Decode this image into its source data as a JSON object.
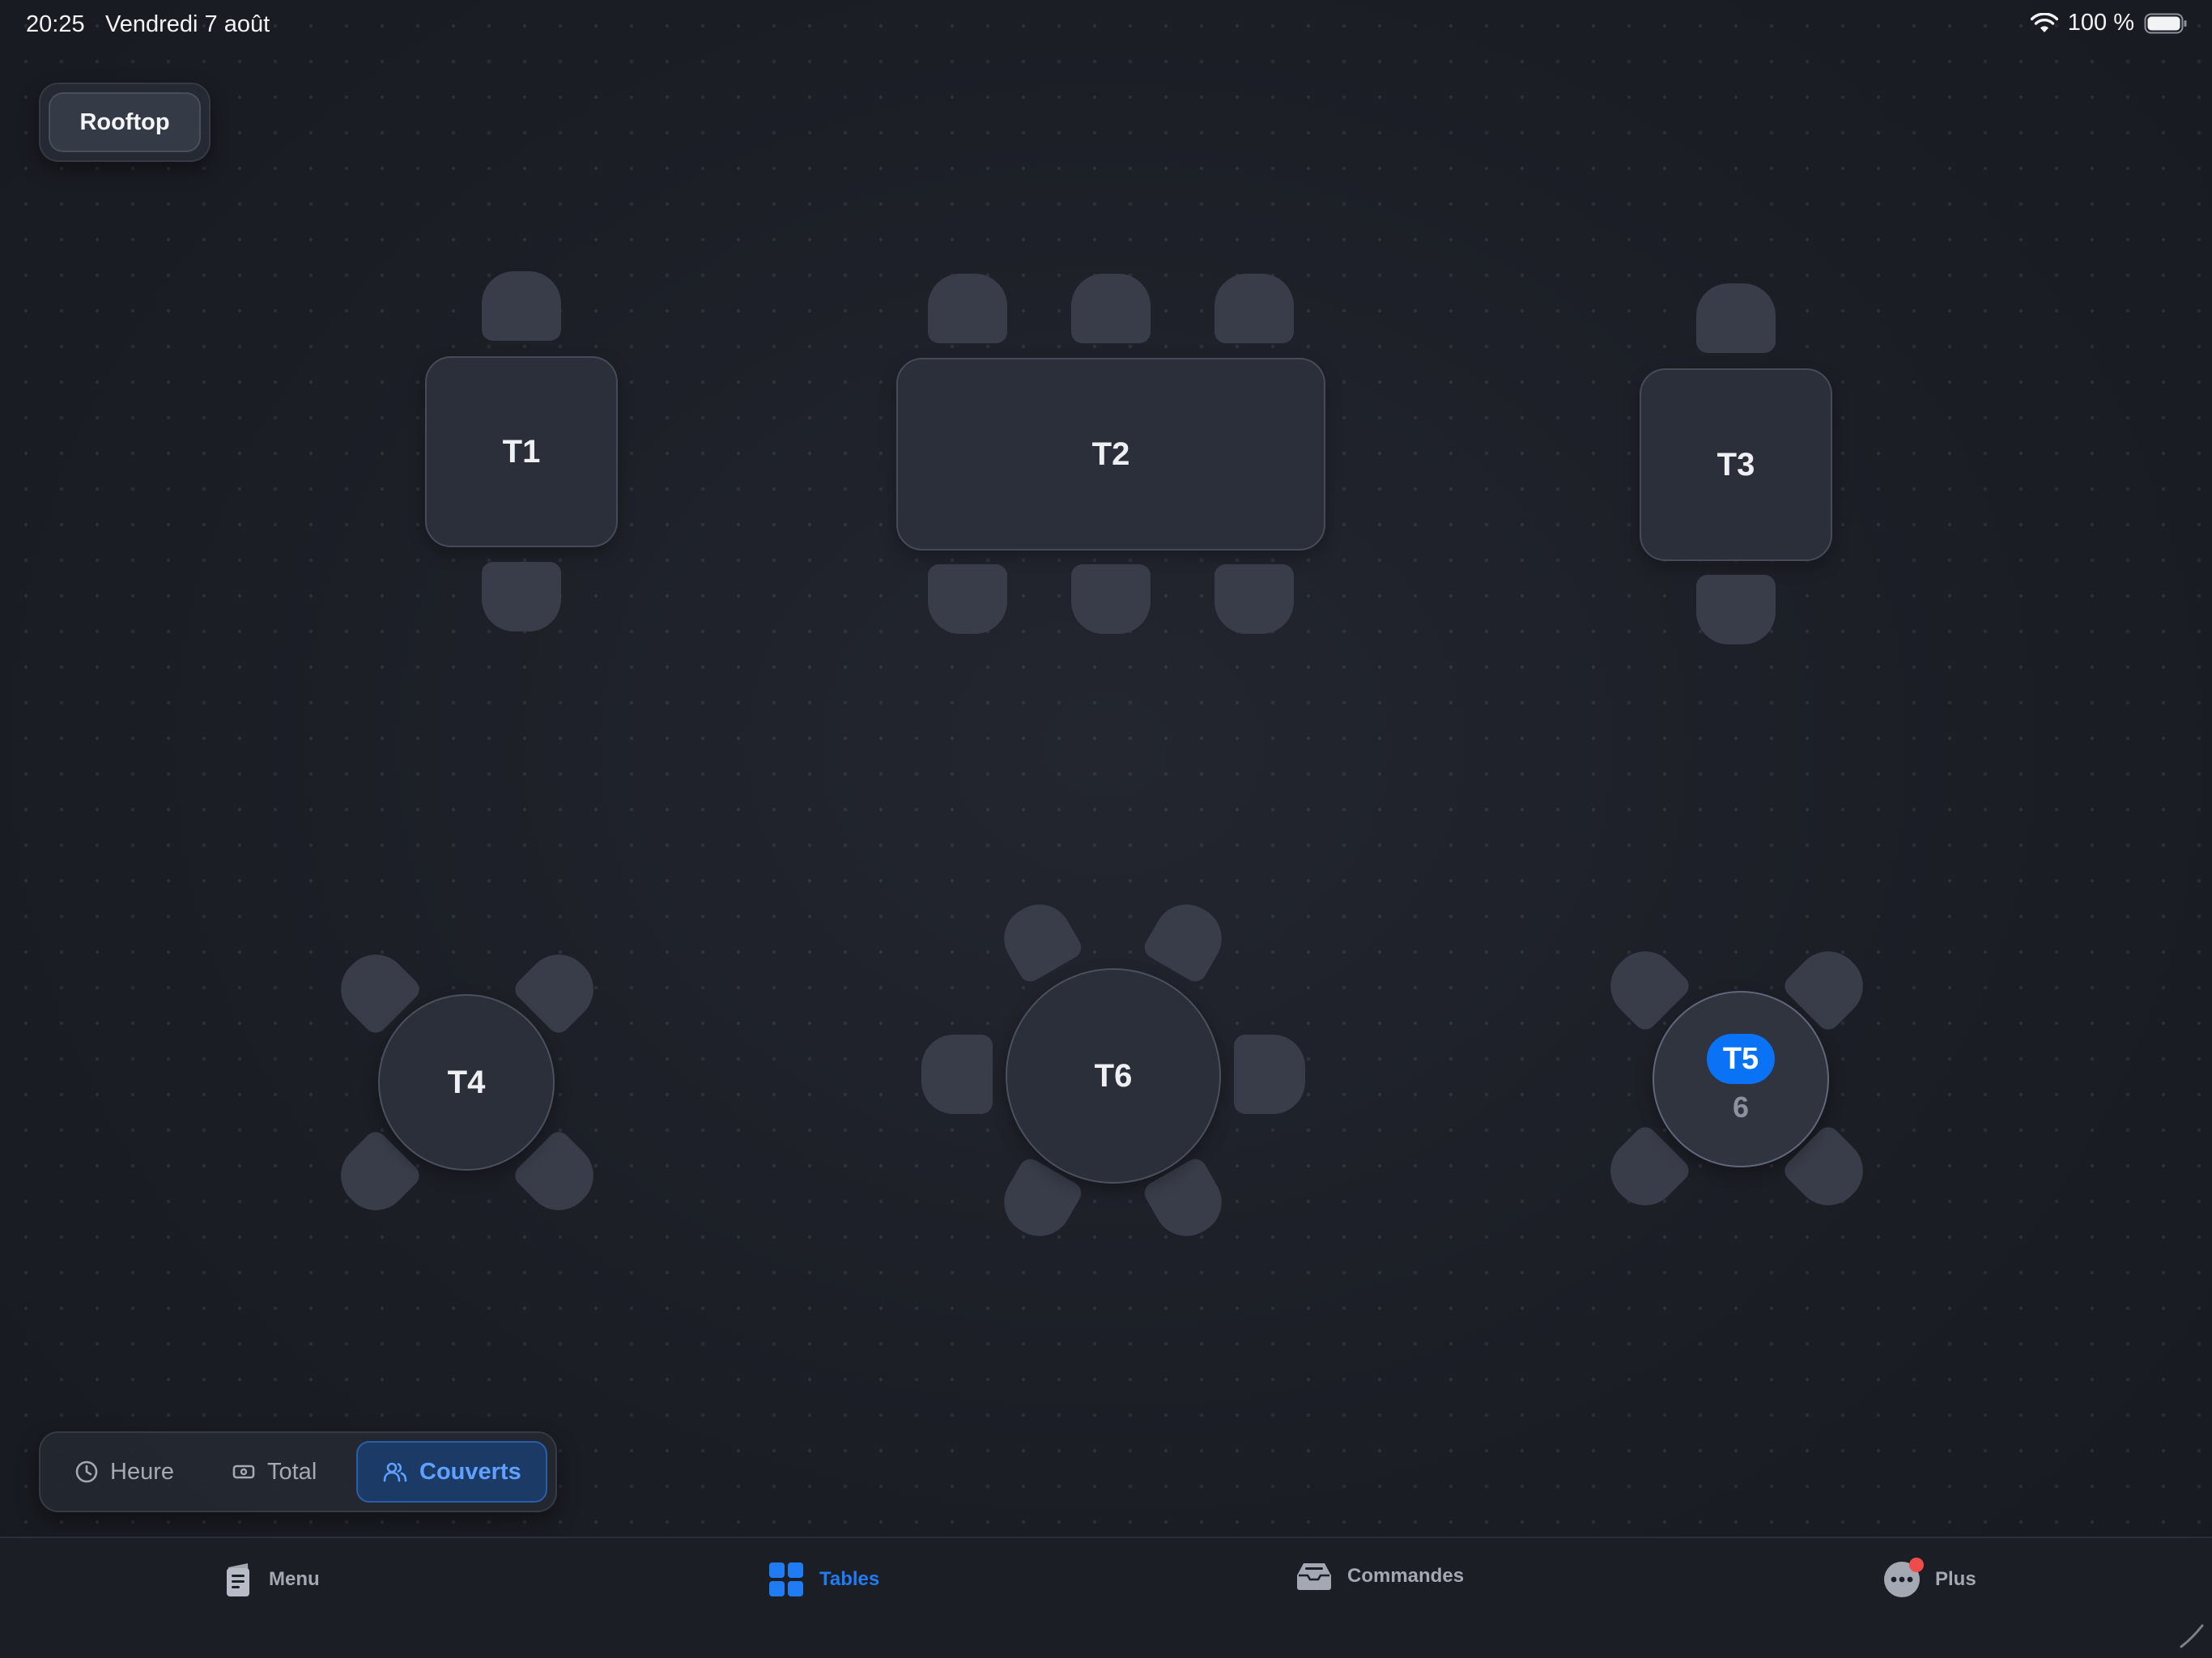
{
  "status_bar": {
    "time": "20:25",
    "date": "Vendredi 7 août",
    "battery": "100 %"
  },
  "room": {
    "label": "Rooftop"
  },
  "tables": {
    "t1": {
      "label": "T1"
    },
    "t2": {
      "label": "T2"
    },
    "t3": {
      "label": "T3"
    },
    "t4": {
      "label": "T4"
    },
    "t5": {
      "label": "T5",
      "covers": "6",
      "selected": true
    },
    "t6": {
      "label": "T6"
    }
  },
  "display_mode": {
    "options": [
      "Heure",
      "Total",
      "Couverts"
    ],
    "selected": "Couverts"
  },
  "tabbar": {
    "items": [
      {
        "label": "Menu",
        "icon": "menu-book-icon"
      },
      {
        "label": "Tables",
        "icon": "grid-icon",
        "active": true
      },
      {
        "label": "Commandes",
        "icon": "tray-icon"
      },
      {
        "label": "Plus",
        "icon": "ellipsis-icon",
        "badge": true
      }
    ]
  },
  "colors": {
    "accent": "#0a72f5",
    "badge": "#ef4b4b",
    "background": "#1d2027"
  }
}
